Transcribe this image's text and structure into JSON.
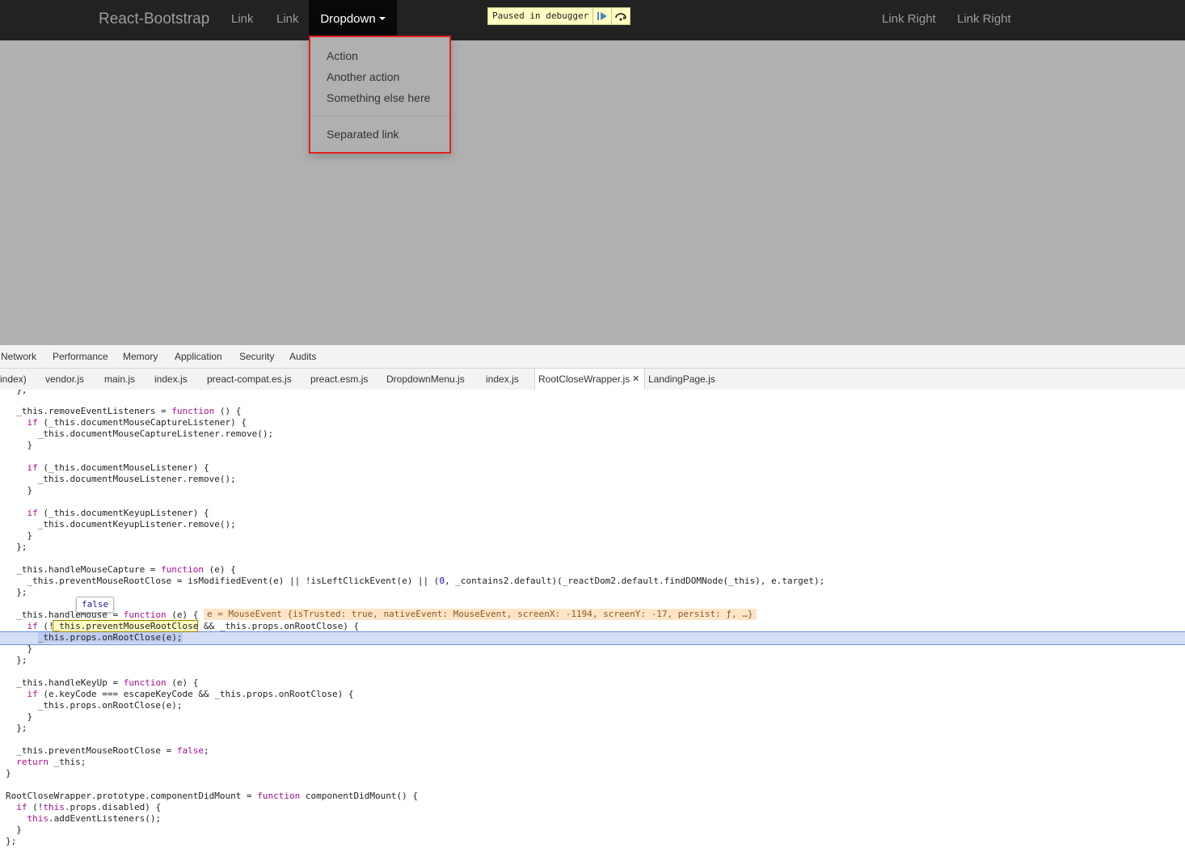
{
  "navbar": {
    "brand": "React-Bootstrap",
    "links_left": [
      "Link",
      "Link"
    ],
    "dropdown_label": "Dropdown",
    "links_right": [
      "Link Right",
      "Link Right"
    ]
  },
  "debugger": {
    "paused_text": "Paused in debugger",
    "resume_icon": "resume-icon",
    "step_over_icon": "step-over-icon"
  },
  "dropdown_menu": {
    "items": [
      "Action",
      "Another action",
      "Something else here"
    ],
    "separated_item": "Separated link"
  },
  "devtools": {
    "tabs": [
      "Network",
      "Performance",
      "Memory",
      "Application",
      "Security",
      "Audits"
    ],
    "file_tabs": [
      "index)",
      "vendor.js",
      "main.js",
      "index.js",
      "preact-compat.es.js",
      "preact.esm.js",
      "DropdownMenu.js",
      "index.js",
      "RootCloseWrapper.js",
      "LandingPage.js"
    ],
    "active_file": "RootCloseWrapper.js",
    "close_glyph": "✕",
    "tooltip_value": "false",
    "inline_value": "e = MouseEvent {isTrusted: true, nativeEvent: MouseEvent, screenX: -1194, screenY: -17, persist: ƒ, …}",
    "code_lines": [
      "  };",
      "",
      "  _this.removeEventListeners = function () {",
      "    if (_this.documentMouseCaptureListener) {",
      "      _this.documentMouseCaptureListener.remove();",
      "    }",
      "",
      "    if (_this.documentMouseListener) {",
      "      _this.documentMouseListener.remove();",
      "    }",
      "",
      "    if (_this.documentKeyupListener) {",
      "      _this.documentKeyupListener.remove();",
      "    }",
      "  };",
      "",
      "  _this.handleMouseCapture = function (e) {",
      "    _this.preventMouseRootClose = isModifiedEvent(e) || !isLeftClickEvent(e) || (0, _contains2.default)(_reactDom2.default.findDOMNode(_this), e.target);",
      "  };",
      "",
      "  _this.handleMouse = function (e) {",
      "    if (!_this.preventMouseRootClose && _this.props.onRootClose) {",
      "      _this.props.onRootClose(e);",
      "    }",
      "  };",
      "",
      "  _this.handleKeyUp = function (e) {",
      "    if (e.keyCode === escapeKeyCode && _this.props.onRootClose) {",
      "      _this.props.onRootClose(e);",
      "    }",
      "  };",
      "",
      "  _this.preventMouseRootClose = false;",
      "  return _this;",
      "}",
      "",
      "RootCloseWrapper.prototype.componentDidMount = function componentDidMount() {",
      "  if (!this.props.disabled) {",
      "    this.addEventListeners();",
      "  }",
      "};"
    ]
  }
}
